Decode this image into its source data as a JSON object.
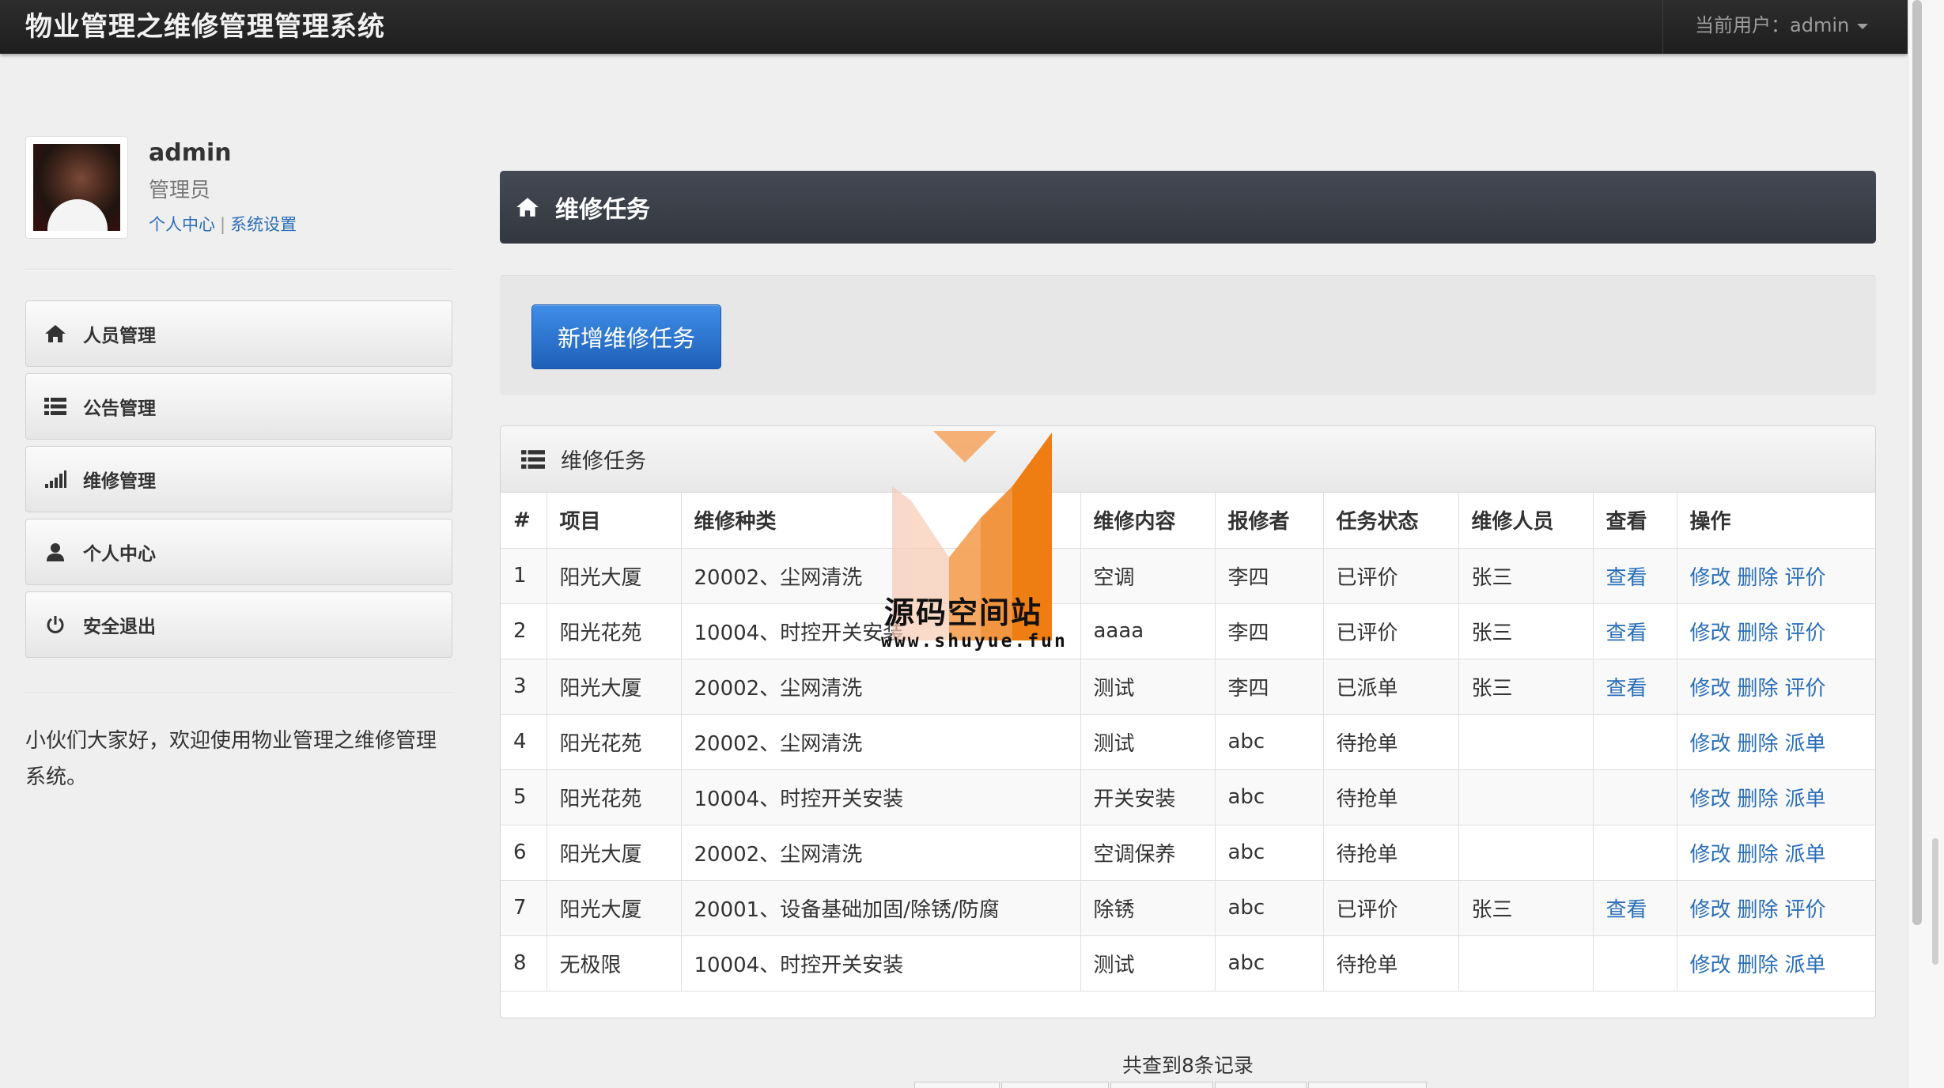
{
  "app": {
    "title": "物业管理之维修管理管理系统"
  },
  "navbar": {
    "current_user_label": "当前用户：admin"
  },
  "profile": {
    "name": "admin",
    "role": "管理员",
    "links": [
      "个人中心",
      "系统设置"
    ]
  },
  "sidebar": {
    "items": [
      {
        "label": "人员管理",
        "icon": "home-icon"
      },
      {
        "label": "公告管理",
        "icon": "list-icon"
      },
      {
        "label": "维修管理",
        "icon": "signal-bars-icon"
      },
      {
        "label": "个人中心",
        "icon": "user-icon"
      },
      {
        "label": "安全退出",
        "icon": "power-icon"
      }
    ],
    "welcome": "小伙们大家好，欢迎使用物业管理之维修管理系统。"
  },
  "main": {
    "header": "维修任务",
    "add_button": "新增维修任务",
    "panel_title": "维修任务",
    "columns": [
      "#",
      "项目",
      "维修种类",
      "维修内容",
      "报修者",
      "任务状态",
      "维修人员",
      "查看",
      "操作"
    ],
    "rows": [
      {
        "id": "1",
        "project": "阳光大厦",
        "type": "20002、尘网清洗",
        "content": "空调",
        "reporter": "李四",
        "status": "已评价",
        "worker": "张三",
        "view": "查看",
        "actions": [
          "修改",
          "删除",
          "评价"
        ]
      },
      {
        "id": "2",
        "project": "阳光花苑",
        "type": "10004、时控开关安装",
        "content": "aaaa",
        "reporter": "李四",
        "status": "已评价",
        "worker": "张三",
        "view": "查看",
        "actions": [
          "修改",
          "删除",
          "评价"
        ]
      },
      {
        "id": "3",
        "project": "阳光大厦",
        "type": "20002、尘网清洗",
        "content": "测试",
        "reporter": "李四",
        "status": "已派单",
        "worker": "张三",
        "view": "查看",
        "actions": [
          "修改",
          "删除",
          "评价"
        ]
      },
      {
        "id": "4",
        "project": "阳光花苑",
        "type": "20002、尘网清洗",
        "content": "测试",
        "reporter": "abc",
        "status": "待抢单",
        "worker": "",
        "view": "",
        "actions": [
          "修改",
          "删除",
          "派单"
        ]
      },
      {
        "id": "5",
        "project": "阳光花苑",
        "type": "10004、时控开关安装",
        "content": "开关安装",
        "reporter": "abc",
        "status": "待抢单",
        "worker": "",
        "view": "",
        "actions": [
          "修改",
          "删除",
          "派单"
        ]
      },
      {
        "id": "6",
        "project": "阳光大厦",
        "type": "20002、尘网清洗",
        "content": "空调保养",
        "reporter": "abc",
        "status": "待抢单",
        "worker": "",
        "view": "",
        "actions": [
          "修改",
          "删除",
          "派单"
        ]
      },
      {
        "id": "7",
        "project": "阳光大厦",
        "type": "20001、设备基础加固/除锈/防腐",
        "content": "除锈",
        "reporter": "abc",
        "status": "已评价",
        "worker": "张三",
        "view": "查看",
        "actions": [
          "修改",
          "删除",
          "评价"
        ]
      },
      {
        "id": "8",
        "project": "无极限",
        "type": "10004、时控开关安装",
        "content": "测试",
        "reporter": "abc",
        "status": "待抢单",
        "worker": "",
        "view": "",
        "actions": [
          "修改",
          "删除",
          "派单"
        ]
      }
    ],
    "footer_count": "共查到8条记录"
  },
  "watermark": {
    "title": "源码空间站",
    "url": "www.shuyue.fun"
  }
}
